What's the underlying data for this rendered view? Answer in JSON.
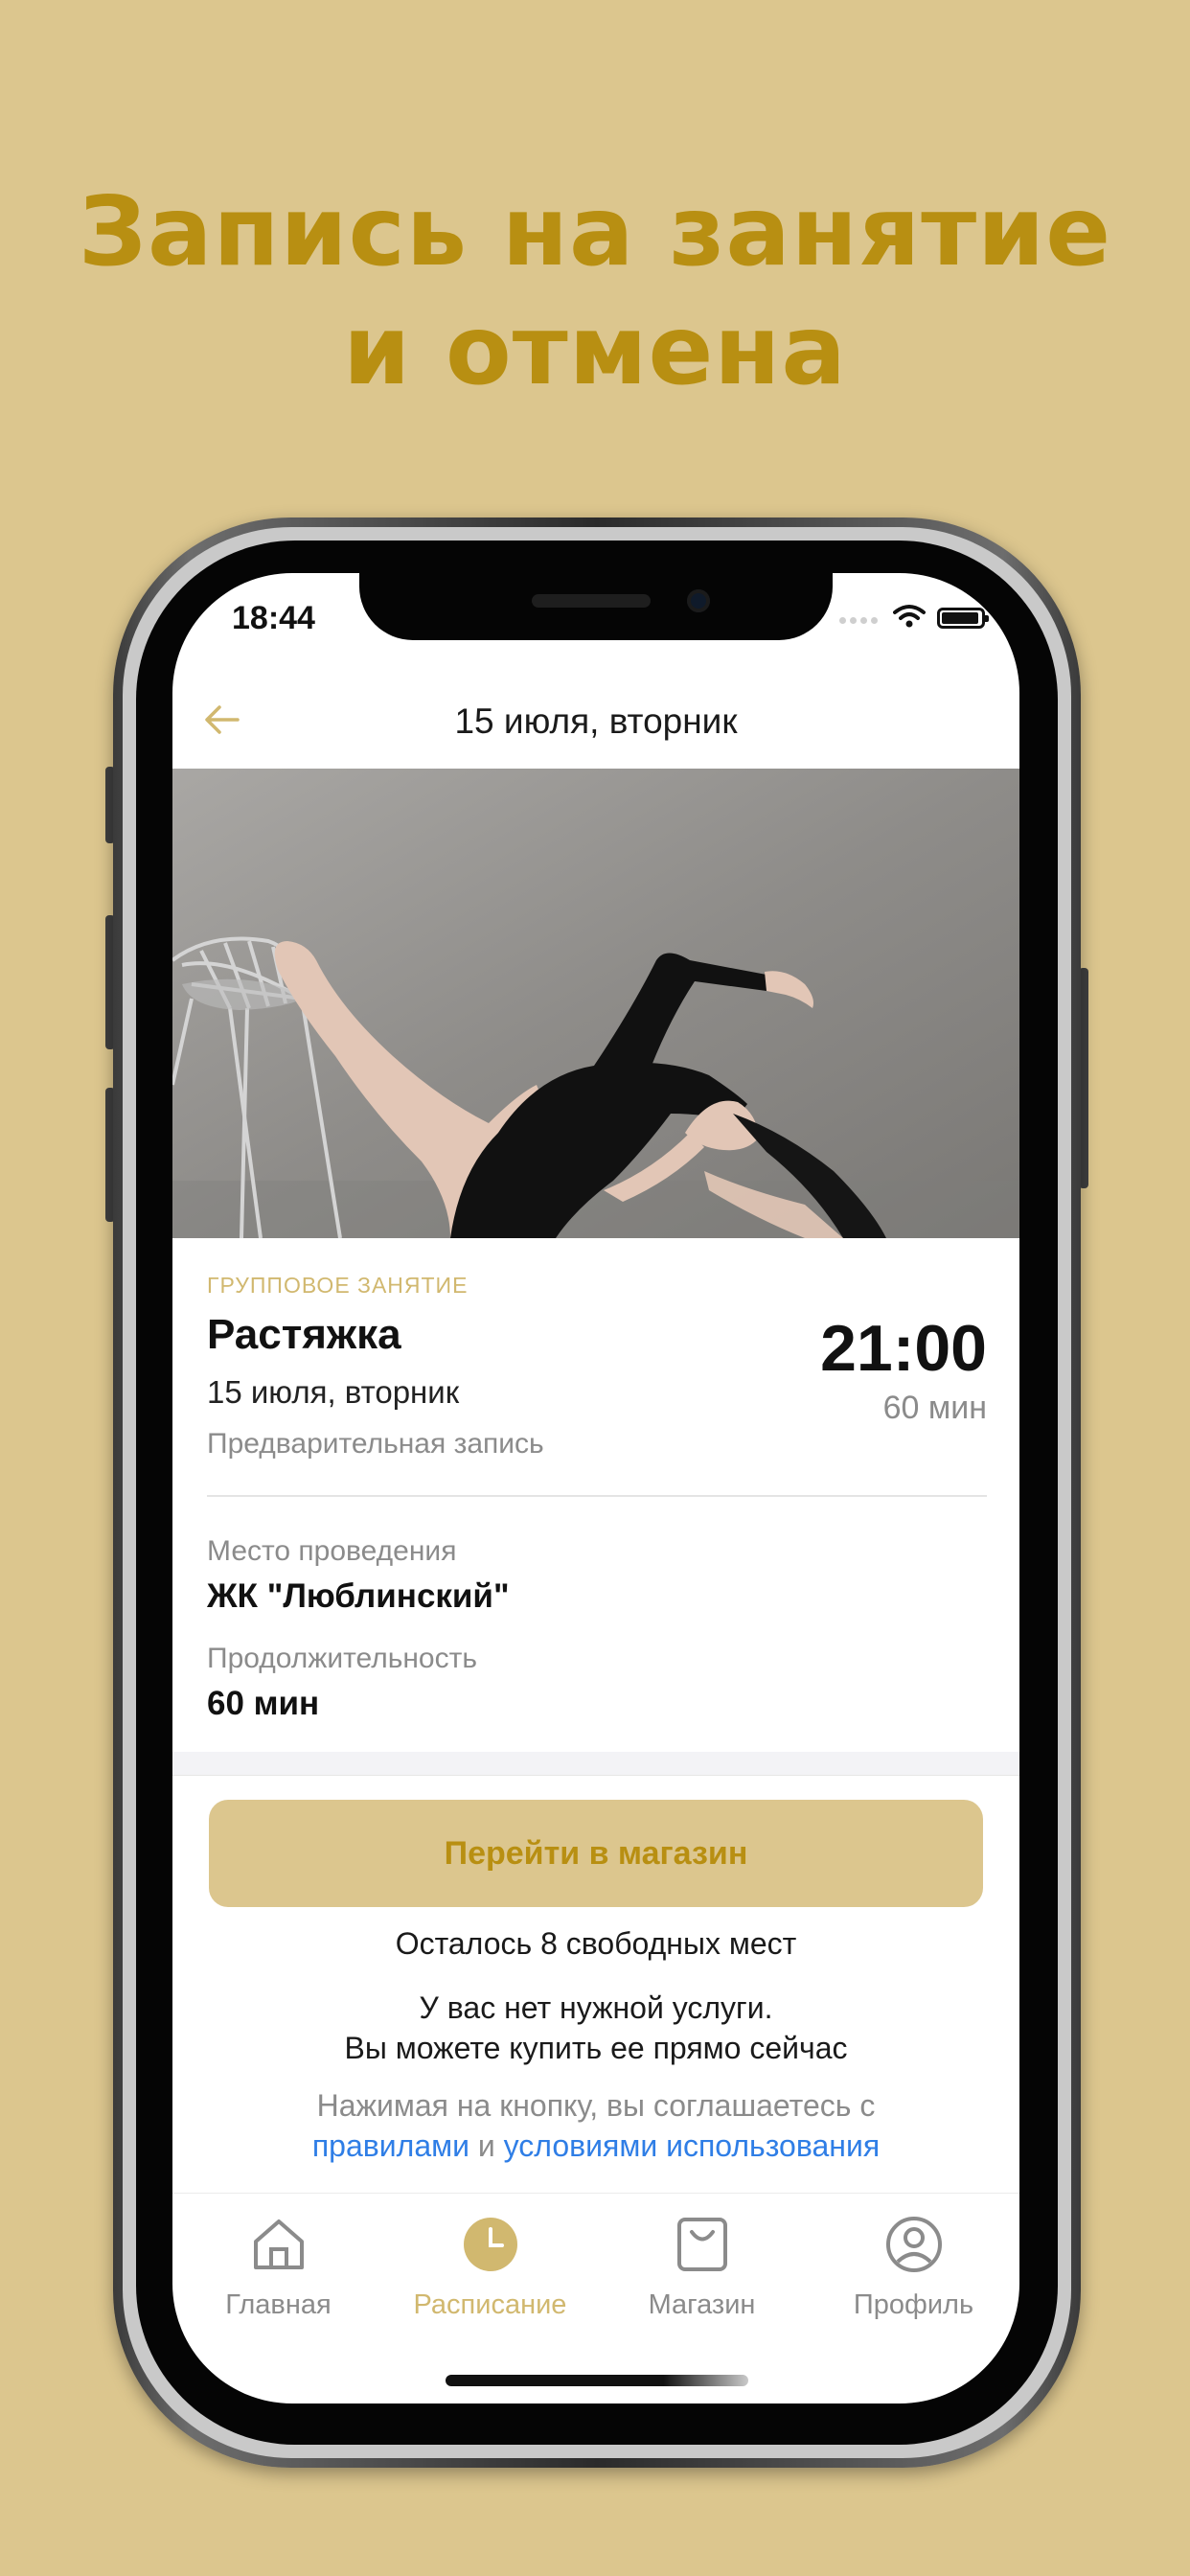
{
  "promo": {
    "line1": "Запись на занятие",
    "line2": "и отмена"
  },
  "status_bar": {
    "time": "18:44",
    "icons": [
      "signal-icon",
      "wifi-icon",
      "battery-icon"
    ]
  },
  "nav": {
    "title": "15 июля, вторник",
    "back_icon": "back-arrow-icon"
  },
  "class": {
    "category": "ГРУППОВОЕ ЗАНЯТИЕ",
    "name": "Растяжка",
    "date": "15 июля, вторник",
    "booking_type": "Предварительная запись",
    "start_time": "21:00",
    "duration": "60 мин"
  },
  "details": {
    "location_label": "Место проведения",
    "location_value": "ЖК \"Люблинский\"",
    "duration_label": "Продолжительность",
    "duration_value": "60 мин"
  },
  "actions": {
    "shop_button": "Перейти в магазин",
    "seats_left": "Осталось 8 свободных мест",
    "notice_line1": "У вас нет нужной услуги.",
    "notice_line2": "Вы можете купить ее прямо сейчас",
    "terms_prefix": "Нажимая на кнопку, вы соглашаетесь с",
    "terms_link_rules": "правилами",
    "terms_and": "и",
    "terms_link_conditions": "условиями использования"
  },
  "tabs": [
    {
      "label": "Главная",
      "icon": "home-icon",
      "active": false
    },
    {
      "label": "Расписание",
      "icon": "clock-icon",
      "active": true
    },
    {
      "label": "Магазин",
      "icon": "shopping-bag-icon",
      "active": false
    },
    {
      "label": "Профиль",
      "icon": "profile-icon",
      "active": false
    }
  ],
  "colors": {
    "background": "#dcc68e",
    "accent": "#b88f12",
    "accent_light": "#d1b86f",
    "link": "#2f7ee6",
    "muted_text": "#8b8b8b"
  }
}
